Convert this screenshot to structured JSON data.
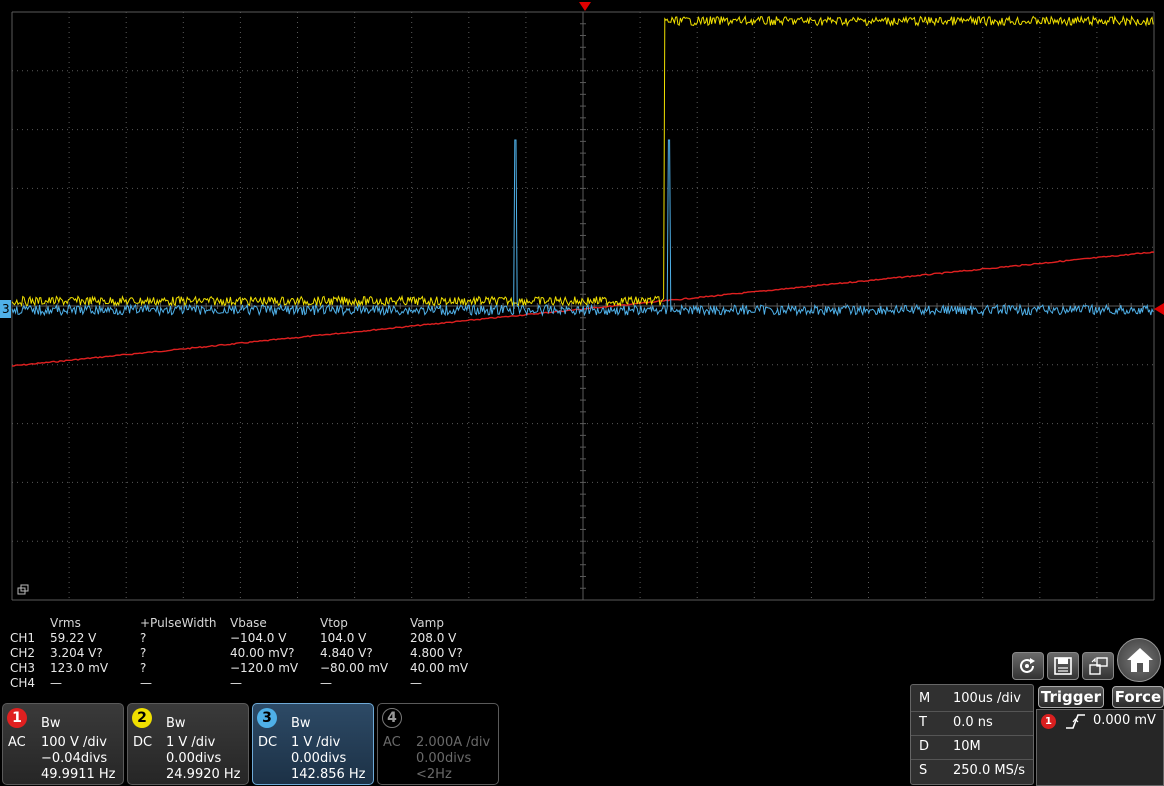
{
  "measurements": {
    "headers": [
      "Vrms",
      "+PulseWidth",
      "Vbase",
      "Vtop",
      "Vamp"
    ],
    "rows": [
      {
        "ch": "CH1",
        "values": [
          "59.22 V",
          "?",
          "−104.0 V",
          "104.0 V",
          "208.0 V"
        ]
      },
      {
        "ch": "CH2",
        "values": [
          "3.204 V?",
          "?",
          "40.00 mV?",
          "4.840 V?",
          "4.800 V?"
        ]
      },
      {
        "ch": "CH3",
        "values": [
          "123.0 mV",
          "?",
          "−120.0 mV",
          "−80.00 mV",
          "40.00 mV"
        ]
      },
      {
        "ch": "CH4",
        "values": [
          "—",
          "—",
          "—",
          "—",
          "—"
        ]
      }
    ]
  },
  "channels": [
    {
      "num": "1",
      "bw": "Bw",
      "coupling": "AC",
      "scale": "100 V /div",
      "offset": "−0.04divs",
      "freq": "49.9911 Hz",
      "color": "#e02020"
    },
    {
      "num": "2",
      "bw": "Bw",
      "coupling": "DC",
      "scale": "1 V /div",
      "offset": "0.00divs",
      "freq": "24.9920 Hz",
      "color": "#f0e000"
    },
    {
      "num": "3",
      "bw": "Bw",
      "coupling": "DC",
      "scale": "1 V /div",
      "offset": "0.00divs",
      "freq": "142.856 Hz",
      "color": "#4fb0e8"
    },
    {
      "num": "4",
      "bw": "",
      "coupling": "AC",
      "scale": "2.000A /div",
      "offset": "0.00divs",
      "freq": "<2Hz",
      "color": "#666666"
    }
  ],
  "timebase": [
    {
      "key": "M",
      "value": "100us /div"
    },
    {
      "key": "T",
      "value": "0.0 ns"
    },
    {
      "key": "D",
      "value": "10M"
    },
    {
      "key": "S",
      "value": "250.0 MS/s"
    }
  ],
  "trigger": {
    "button": "Trigger",
    "force": "Force",
    "source": "1",
    "level": "0.000 mV"
  },
  "markers": {
    "ch3_label": "3"
  },
  "colors": {
    "ch1": "#e02020",
    "ch2": "#f0e000",
    "ch3": "#4fb0e8",
    "grid": "#5a5a5a",
    "trigger_marker": "#e00000"
  }
}
